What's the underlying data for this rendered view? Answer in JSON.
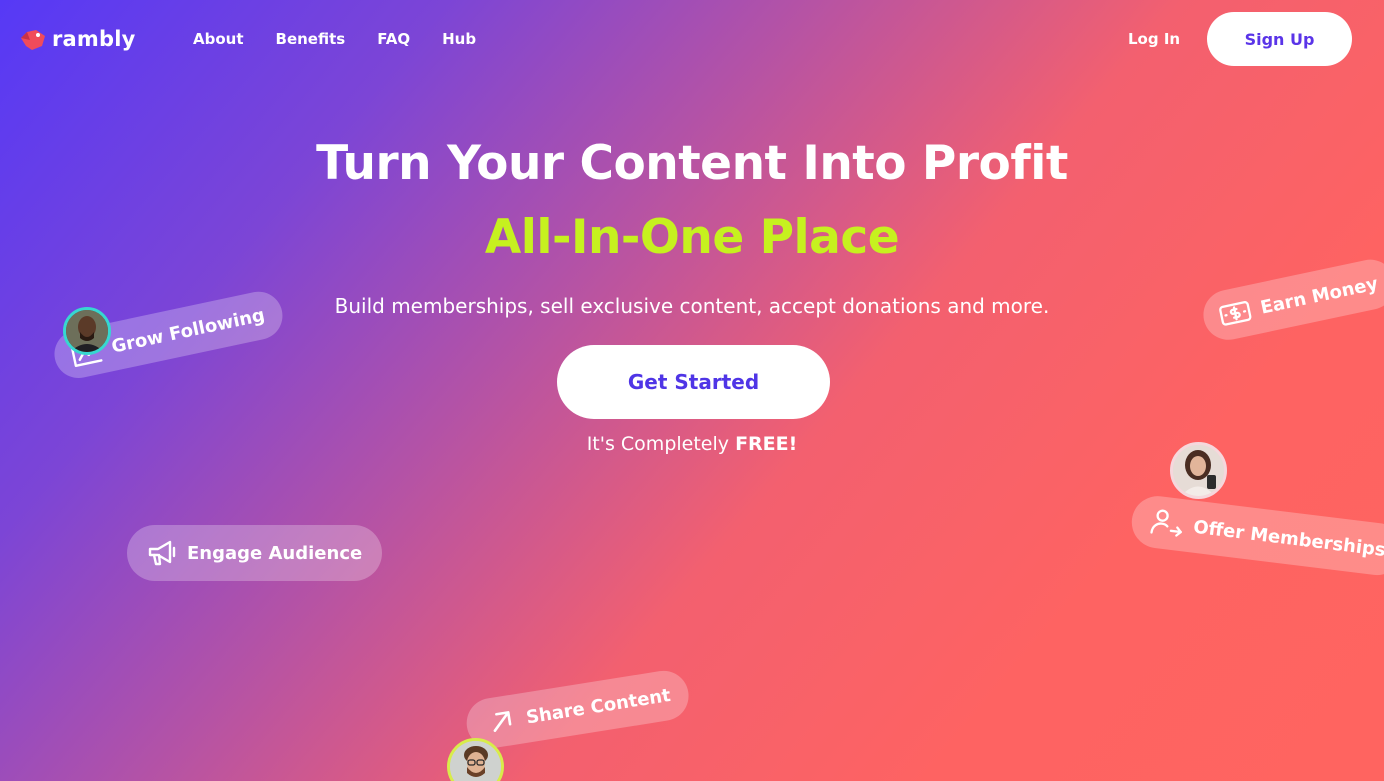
{
  "brand": {
    "name": "rambly",
    "logo_color": "#f04b5b"
  },
  "nav": {
    "links": [
      "About",
      "Benefits",
      "FAQ",
      "Hub"
    ]
  },
  "auth": {
    "login_label": "Log In",
    "signup_label": "Sign Up"
  },
  "hero": {
    "headline": "Turn Your Content Into Profit",
    "subheadline": "All-In-One Place",
    "tagline": "Build memberships, sell exclusive content, accept donations and more.",
    "cta_label": "Get Started",
    "free_prefix": "It's Completely ",
    "free_emphasis": "FREE!"
  },
  "features": {
    "grow": "Grow Following",
    "engage": "Engage Audience",
    "earn": "Earn Money",
    "offer": "Offer Memberships",
    "share": "Share Content"
  },
  "colors": {
    "gradient_start": "#5639f6",
    "gradient_end": "#ff6460",
    "accent_green": "#c6f11f",
    "button_text": "#5a34e8"
  }
}
